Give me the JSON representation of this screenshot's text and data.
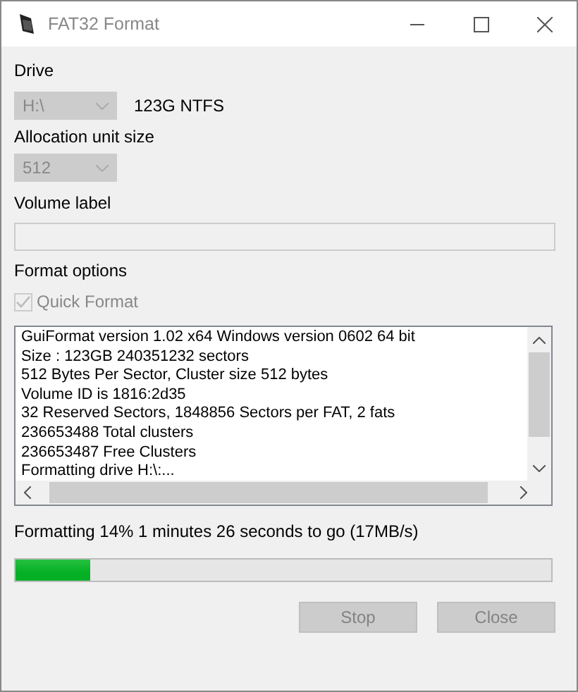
{
  "window": {
    "title": "FAT32 Format"
  },
  "drive": {
    "label": "Drive",
    "value": "H:\\",
    "disabled": true,
    "info": "123G NTFS"
  },
  "allocation": {
    "label": "Allocation unit size",
    "value": "512",
    "disabled": true
  },
  "volume_label": {
    "label": "Volume label",
    "disabled": true
  },
  "format_options": {
    "label": "Format options",
    "quick_format": {
      "label": "Quick Format",
      "checked": true,
      "disabled": true
    }
  },
  "log": [
    "GuiFormat version 1.02 x64 Windows version 0602 64 bit",
    "Size : 123GB 240351232 sectors",
    "512 Bytes Per Sector, Cluster size 512 bytes",
    "Volume ID is 1816:2d35",
    "32 Reserved Sectors, 1848856 Sectors per FAT, 2 fats",
    "236653488 Total clusters",
    "236653487 Free Clusters",
    "Formatting drive H:\\:..."
  ],
  "status": "Formatting 14% 1 minutes 26 seconds to go (17MB/s)",
  "progress": {
    "level": 0.14
  },
  "buttons": [
    {
      "label": "Stop",
      "disabled": true
    },
    {
      "label": "Close",
      "disabled": true
    }
  ]
}
